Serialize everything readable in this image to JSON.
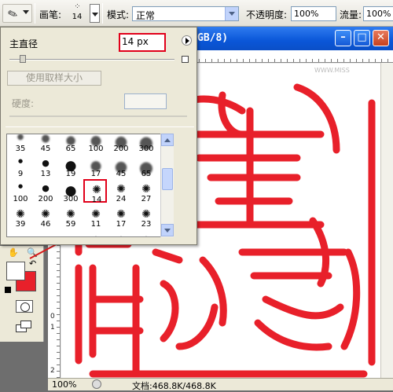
{
  "options_bar": {
    "tool_preset_icon": "brush-icon",
    "brush_label": "画笔:",
    "brush_size_label": "14",
    "mode_label": "模式:",
    "mode_value": "正常",
    "opacity_label": "不透明度:",
    "opacity_value": "100%",
    "flow_label": "流量:",
    "flow_value": "100%"
  },
  "brush_picker": {
    "master_diameter_label": "主直径",
    "master_diameter_value": "14 px",
    "use_sample_size_label": "使用取样大小",
    "hardness_label": "硬度:",
    "brushes": [
      {
        "label": "35",
        "kind": "soft"
      },
      {
        "label": "45",
        "kind": "soft"
      },
      {
        "label": "65",
        "kind": "soft"
      },
      {
        "label": "100",
        "kind": "soft"
      },
      {
        "label": "200",
        "kind": "soft"
      },
      {
        "label": "300",
        "kind": "soft"
      },
      {
        "label": "9",
        "kind": "hard"
      },
      {
        "label": "13",
        "kind": "hard"
      },
      {
        "label": "19",
        "kind": "hard"
      },
      {
        "label": "17",
        "kind": "soft"
      },
      {
        "label": "45",
        "kind": "soft"
      },
      {
        "label": "65",
        "kind": "soft"
      },
      {
        "label": "100",
        "kind": "hard"
      },
      {
        "label": "200",
        "kind": "hard"
      },
      {
        "label": "300",
        "kind": "hard"
      },
      {
        "label": "14",
        "kind": "splatter"
      },
      {
        "label": "24",
        "kind": "splatter"
      },
      {
        "label": "27",
        "kind": "splatter"
      },
      {
        "label": "39",
        "kind": "splatter"
      },
      {
        "label": "46",
        "kind": "splatter"
      },
      {
        "label": "59",
        "kind": "splatter"
      },
      {
        "label": "11",
        "kind": "splatter"
      },
      {
        "label": "17",
        "kind": "splatter"
      },
      {
        "label": "23",
        "kind": "splatter"
      },
      {
        "label": "",
        "kind": "texture"
      },
      {
        "label": "",
        "kind": "texture"
      },
      {
        "label": "",
        "kind": "texture"
      },
      {
        "label": "",
        "kind": "small"
      },
      {
        "label": "",
        "kind": "small"
      },
      {
        "label": "",
        "kind": "small"
      }
    ],
    "selected_brush": "14"
  },
  "document": {
    "title_fragment": "GB/8)",
    "ruler_top_numbers": [],
    "ruler_left_numbers": [
      "0",
      "1",
      "2"
    ],
    "status_zoom": "100%",
    "status_doc": "文档:468.8K/468.8K",
    "watermark": "WWW.MISS"
  },
  "colors": {
    "accent_red": "#e8202a",
    "selection_red": "#e1001a",
    "title_blue": "#0a56d8",
    "foreground": "#ffffff",
    "background": "#e8202a"
  }
}
